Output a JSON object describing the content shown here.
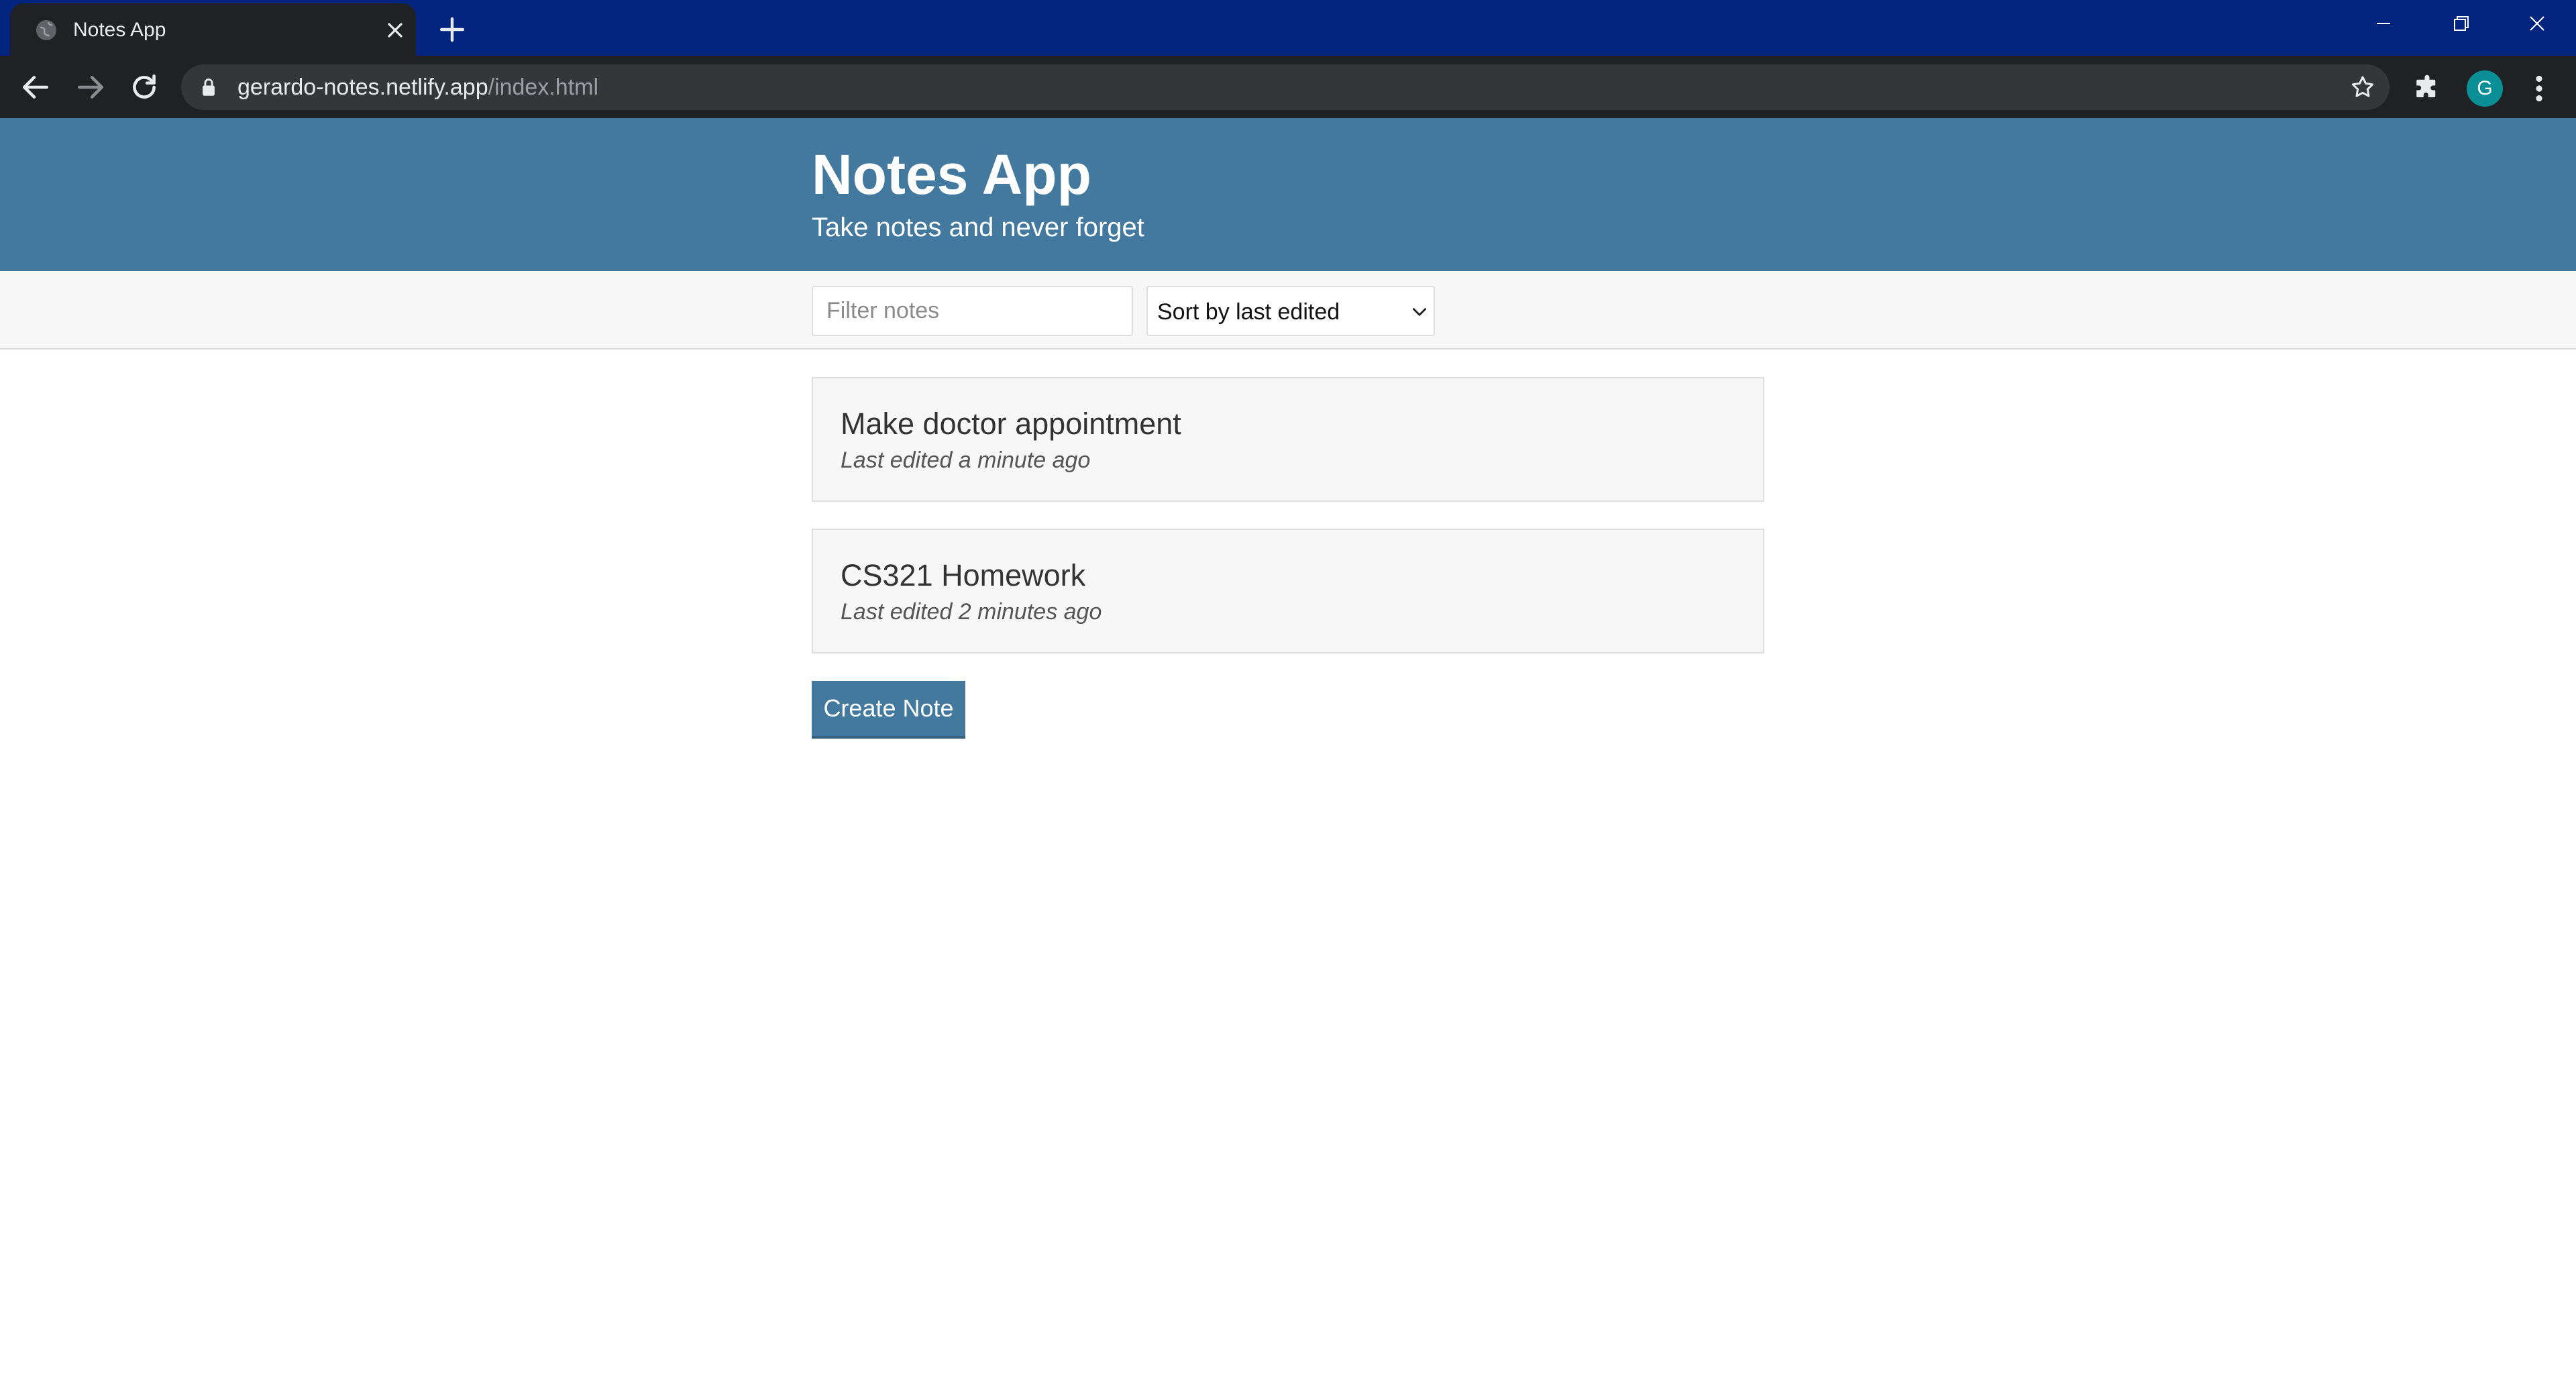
{
  "browser": {
    "tab_title": "Notes App",
    "url_host": "gerardo-notes.netlify.app",
    "url_path": "/index.html",
    "profile_initial": "G",
    "icons": {
      "favicon": "globe-icon",
      "tab_close": "close-icon",
      "new_tab": "plus-icon",
      "back": "arrow-left-icon",
      "forward": "arrow-right-icon",
      "reload": "reload-icon",
      "lock": "lock-icon",
      "bookmark": "star-icon",
      "extensions": "puzzle-icon",
      "menu": "kebab-menu-icon"
    },
    "colors": {
      "tabbar": "#04257f",
      "toolbar": "#202124",
      "avatar": "#0b8f97"
    }
  },
  "header": {
    "title": "Notes App",
    "subtitle": "Take notes and never forget"
  },
  "actions": {
    "filter_placeholder": "Filter notes",
    "filter_value": "",
    "sort_selected": "Sort by last edited"
  },
  "notes": [
    {
      "title": "Make doctor appointment",
      "meta": "Last edited a minute ago"
    },
    {
      "title": "CS321 Homework",
      "meta": "Last edited 2 minutes ago"
    }
  ],
  "create_button_label": "Create Note",
  "colors": {
    "header_bg": "#43799e",
    "actions_bg": "#f7f7f7",
    "note_bg": "#f7f7f7",
    "button_bg": "#43799e"
  }
}
